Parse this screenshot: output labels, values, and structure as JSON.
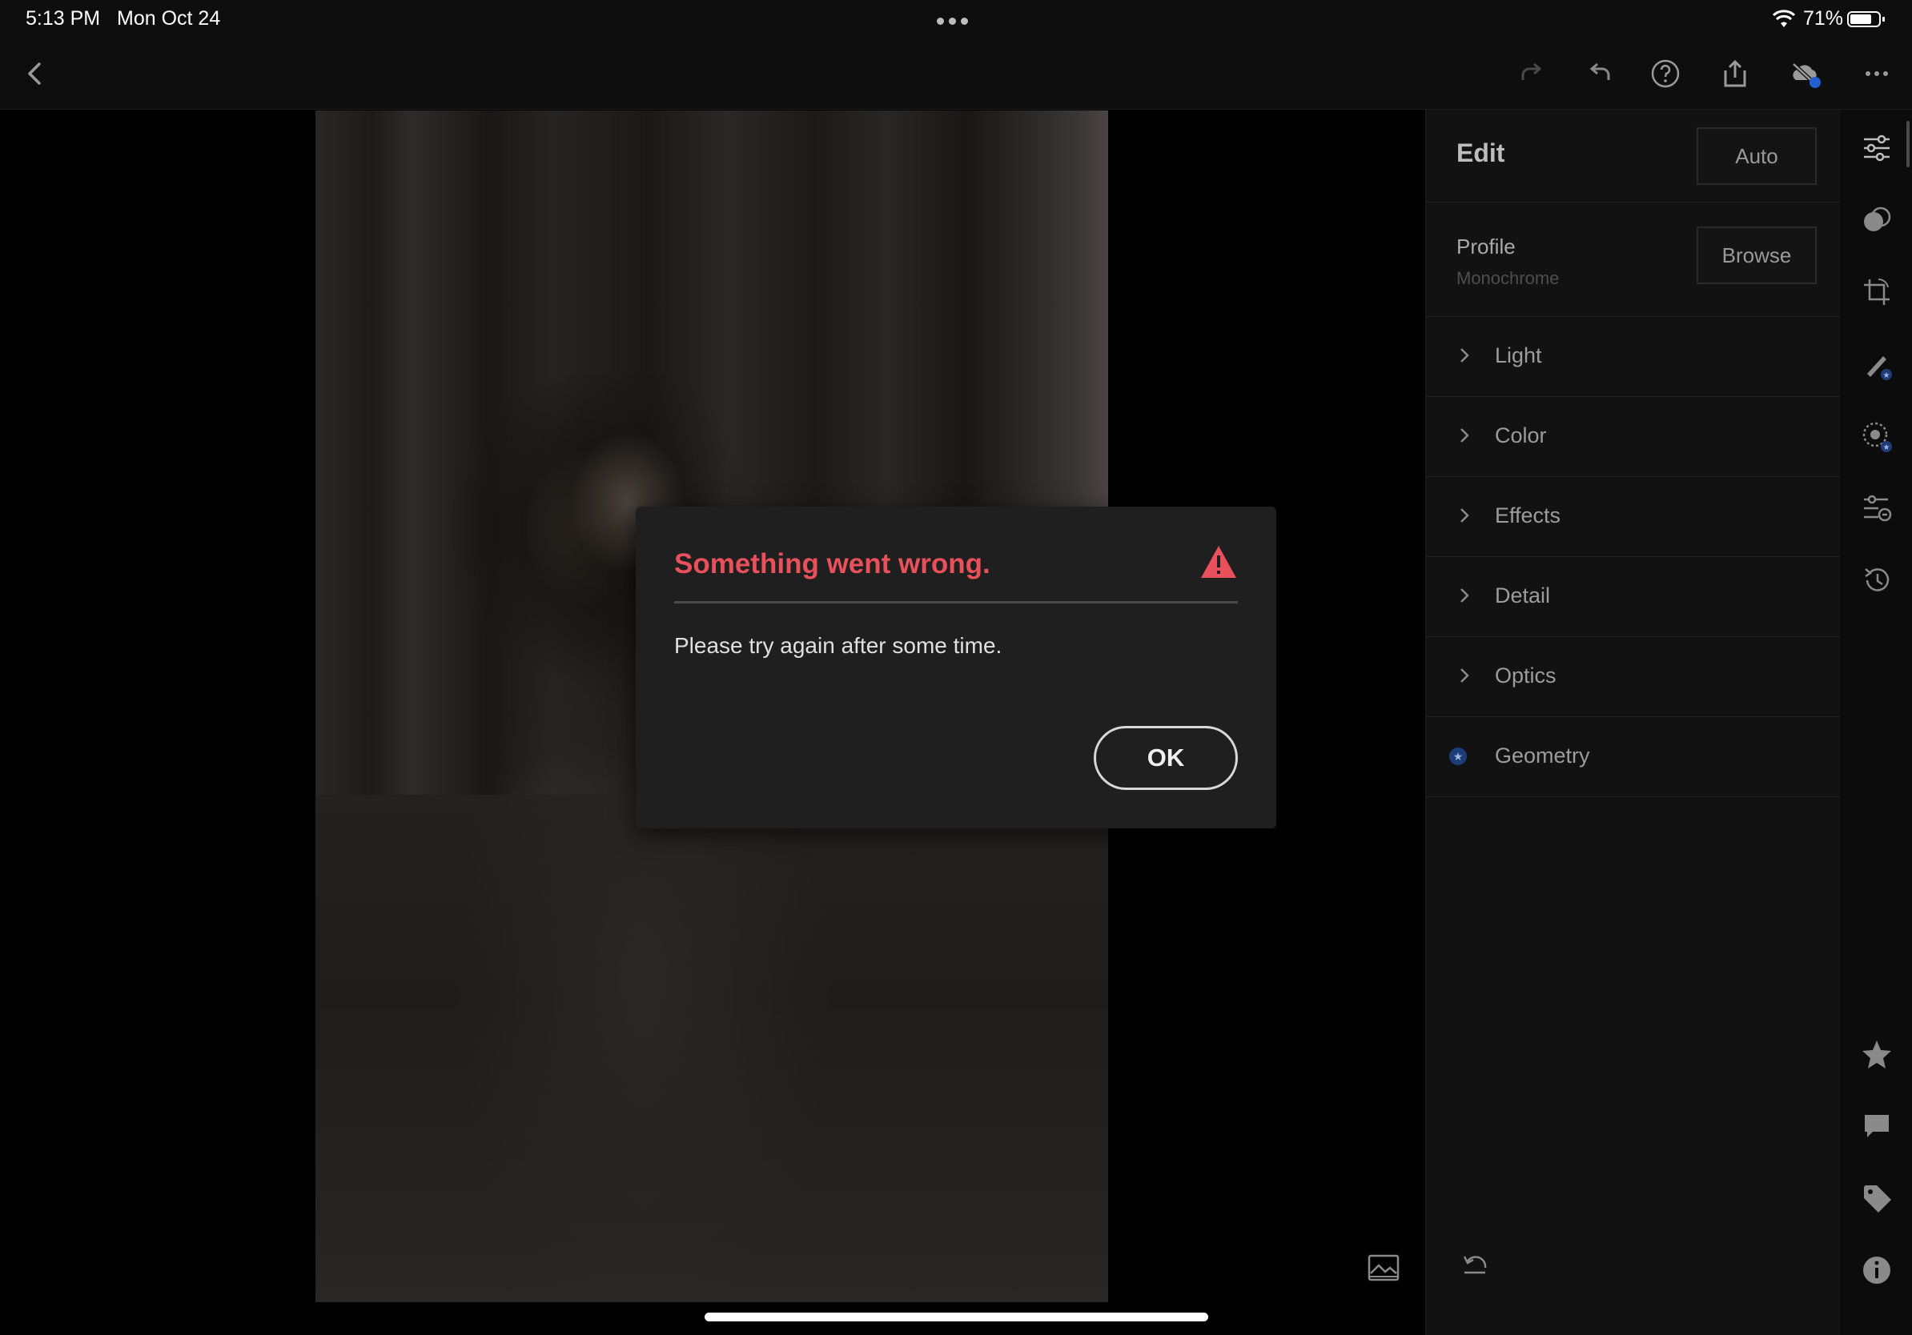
{
  "status_bar": {
    "time": "5:13 PM",
    "date": "Mon Oct 24",
    "battery": "71%"
  },
  "toolbar": {
    "icons": [
      "back-chevron-icon",
      "redo-icon",
      "undo-icon",
      "help-icon",
      "share-icon",
      "cloud-sync-off-icon",
      "more-icon"
    ]
  },
  "edit_panel": {
    "title": "Edit",
    "auto_label": "Auto",
    "profile_label": "Profile",
    "profile_value": "Monochrome",
    "browse_label": "Browse",
    "sections": [
      {
        "label": "Light",
        "icon": "chevron-right-icon"
      },
      {
        "label": "Color",
        "icon": "chevron-right-icon"
      },
      {
        "label": "Effects",
        "icon": "chevron-right-icon"
      },
      {
        "label": "Detail",
        "icon": "chevron-right-icon"
      },
      {
        "label": "Optics",
        "icon": "chevron-right-icon"
      },
      {
        "label": "Geometry",
        "icon": "premium-star-badge-icon"
      }
    ]
  },
  "right_rail": {
    "icons": [
      "edit-sliders-icon",
      "masking-icon",
      "crop-icon",
      "healing-icon",
      "selective-icon",
      "presets-icon",
      "versions-icon",
      "rating-star-icon",
      "comment-icon",
      "tag-icon",
      "info-icon"
    ]
  },
  "dialog": {
    "title": "Something went wrong.",
    "message": "Please try again after some time.",
    "ok_label": "OK"
  },
  "colors": {
    "accent_error": "#e8505b",
    "premium_badge": "#1e3d78",
    "panel_bg": "#121212"
  }
}
